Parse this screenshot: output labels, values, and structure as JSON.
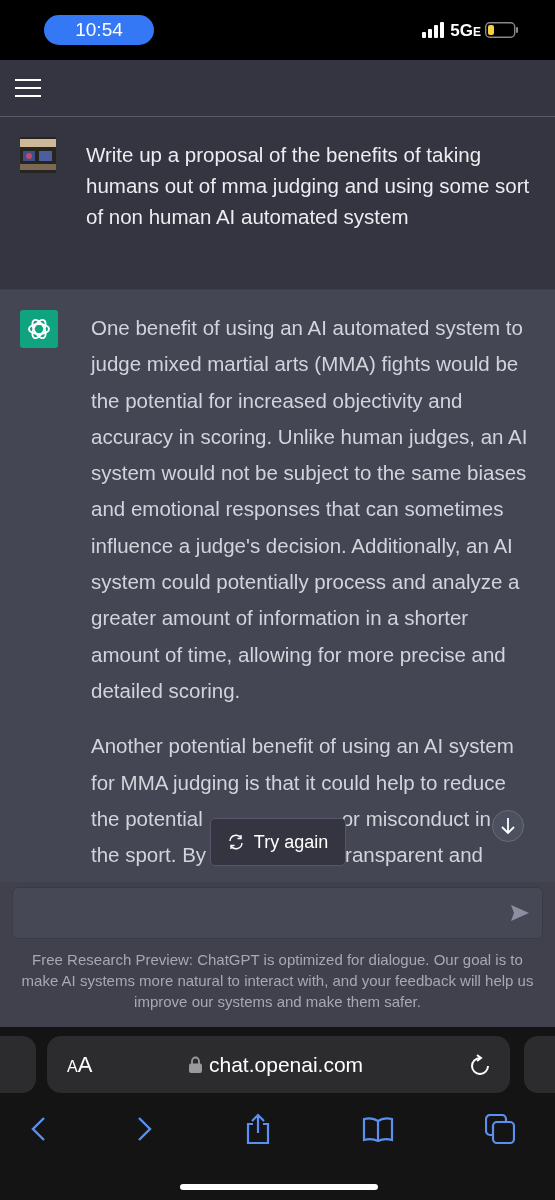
{
  "status_bar": {
    "time": "10:54",
    "network": "5G",
    "network_suffix": "E"
  },
  "messages": [
    {
      "kind": "user",
      "paragraphs": [
        {
          "text": "Write up a proposal of the benefits of taking humans out of mma judging and using some sort of non human AI automated system"
        }
      ]
    },
    {
      "kind": "assistant",
      "paragraphs": [
        {
          "text": "One benefit of using an AI automated system to judge mixed martial arts (MMA) fights would be the potential for increased objectivity and accuracy in scoring. Unlike human judges, an AI system would not be subject to the same biases and emotional responses that can sometimes influence a judge's decision. Additionally, an AI system could potentially process and analyze a greater amount of information in a shorter amount of time, allowing for more precise and detailed scoring."
        },
        {
          "lines": [
            [
              "Another potential benefit of using an AI system"
            ],
            [
              "for MMA judging is that it could help to reduce"
            ],
            [
              "the potential",
              "or misconduct in"
            ],
            [
              "the sport. By",
              "ransparent and"
            ]
          ]
        }
      ]
    }
  ],
  "try_again_button": {
    "label": "Try again"
  },
  "footer_note": "Free Research Preview: ChatGPT is optimized for dialogue. Our goal is to make AI systems more natural to interact with, and your feedback will help us improve our systems and make them safer.",
  "browser": {
    "text_size": "AA",
    "url": "chat.openai.com"
  }
}
